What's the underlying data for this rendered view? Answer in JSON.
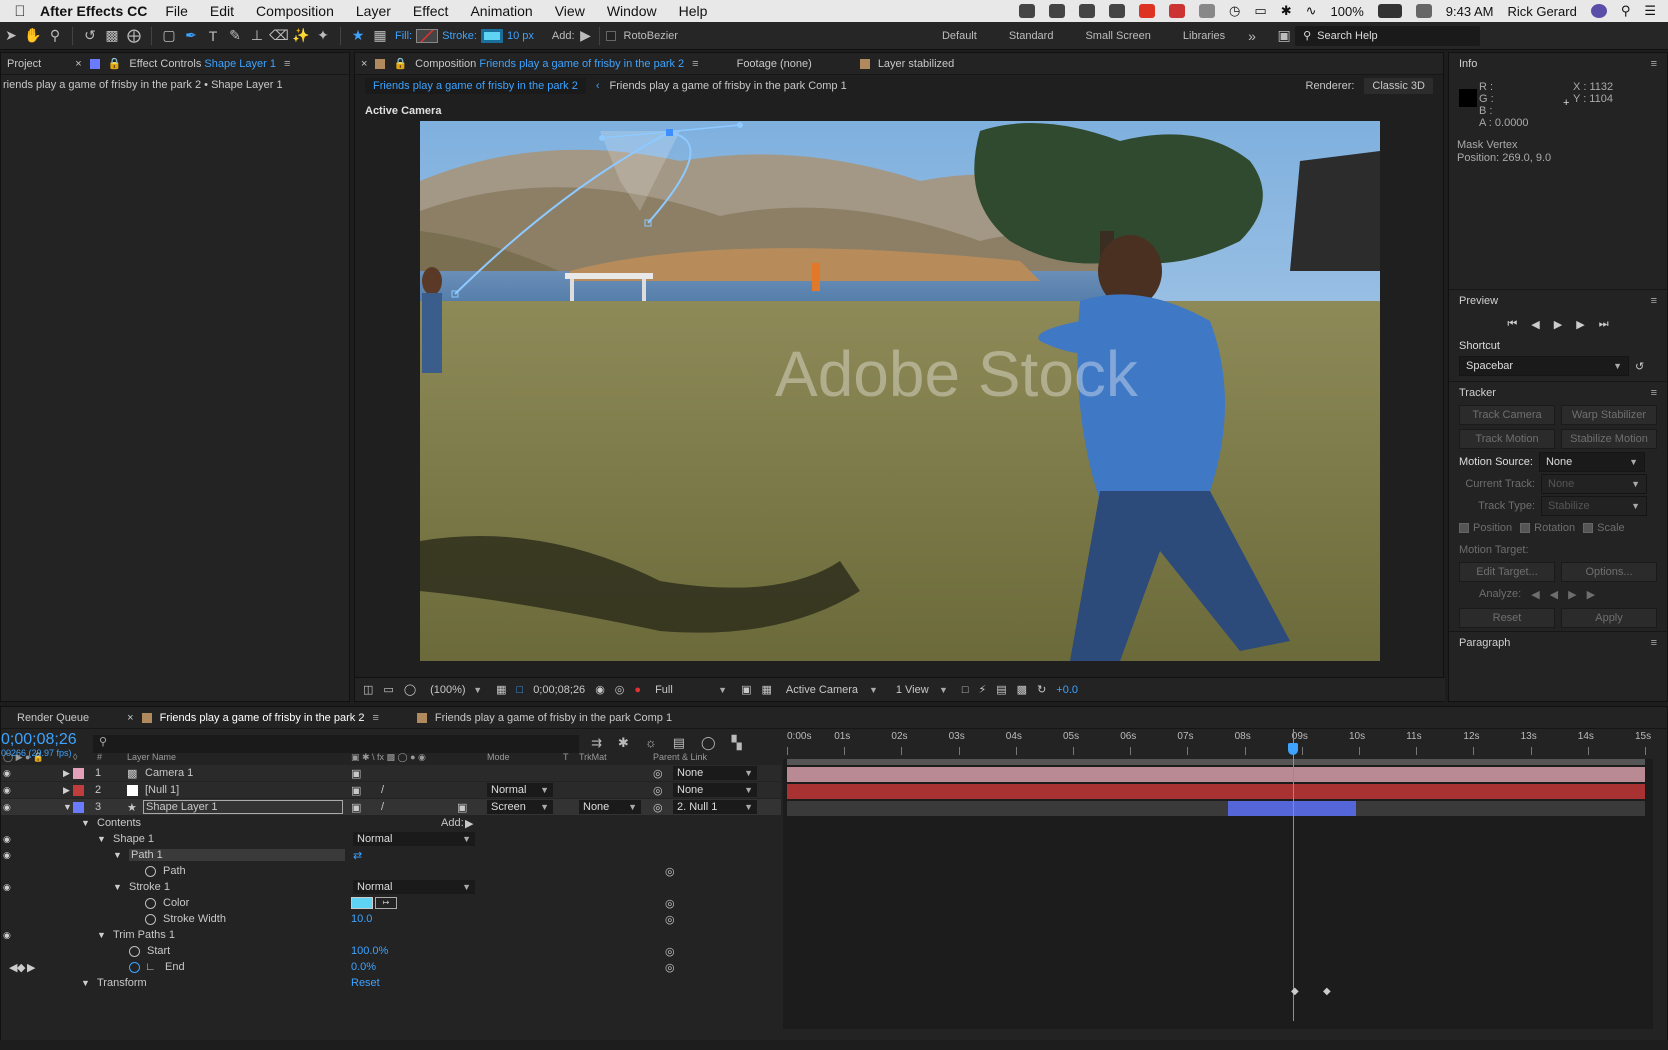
{
  "menubar": {
    "app_name": "After Effects CC",
    "menus": [
      "File",
      "Edit",
      "Composition",
      "Layer",
      "Effect",
      "Animation",
      "View",
      "Window",
      "Help"
    ],
    "battery": "100%",
    "time": "9:43 AM",
    "user": "Rick Gerard"
  },
  "toolbar": {
    "fill_label": "Fill:",
    "stroke_label": "Stroke:",
    "stroke_width": "10 px",
    "add_label": "Add:",
    "rotobezier": "RotoBezier",
    "workspaces": [
      "Default",
      "Standard",
      "Small Screen",
      "Libraries"
    ],
    "search_help": "Search Help",
    "stroke_color": "#5fd3f3"
  },
  "left_panel": {
    "tab_project": "Project",
    "tab_effect_controls_prefix": "Effect Controls",
    "tab_effect_controls_layer": "Shape Layer 1",
    "subtitle": "riends play a game of frisby in the park 2 • Shape Layer 1"
  },
  "comp_panel": {
    "tab_prefix": "Composition",
    "tab_comp_name": "Friends play a game of frisby in the park 2",
    "tab_footage": "Footage (none)",
    "tab_layer": "Layer stabilized",
    "breadcrumb_active": "Friends play a game of frisby in the park 2",
    "breadcrumb_parent": "Friends play a game of frisby in the park Comp 1",
    "renderer_label": "Renderer:",
    "renderer_value": "Classic 3D",
    "active_camera": "Active Camera",
    "watermark": "Adobe Stock",
    "footer": {
      "zoom": "(100%)",
      "timecode": "0;00;08;26",
      "resolution": "Full",
      "camera": "Active Camera",
      "views": "1 View",
      "exposure": "+0.0"
    }
  },
  "info_panel": {
    "title": "Info",
    "r": "R :",
    "g": "G :",
    "b": "B :",
    "a": "A : 0.0000",
    "x": "X : 1132",
    "y": "Y : 1104",
    "mask_vertex": "Mask Vertex",
    "position": "Position: 269.0, 9.0"
  },
  "preview_panel": {
    "title": "Preview",
    "shortcut_label": "Shortcut",
    "shortcut_value": "Spacebar"
  },
  "tracker_panel": {
    "title": "Tracker",
    "track_camera": "Track Camera",
    "warp_stabilizer": "Warp Stabilizer",
    "track_motion": "Track Motion",
    "stabilize_motion": "Stabilize Motion",
    "motion_source_label": "Motion Source:",
    "motion_source_value": "None",
    "current_track_label": "Current Track:",
    "current_track_value": "None",
    "track_type_label": "Track Type:",
    "track_type_value": "Stabilize",
    "position": "Position",
    "rotation": "Rotation",
    "scale": "Scale",
    "motion_target": "Motion Target:",
    "edit_target": "Edit Target...",
    "options": "Options...",
    "analyze": "Analyze:",
    "reset": "Reset",
    "apply": "Apply"
  },
  "paragraph_panel": {
    "title": "Paragraph"
  },
  "timeline": {
    "tab_render_queue": "Render Queue",
    "tab_comp": "Friends play a game of frisby in the park 2",
    "tab_comp2": "Friends play a game of frisby in the park Comp 1",
    "timecode": "0;00;08;26",
    "fps": "00266 (29.97 fps)",
    "col_hash": "#",
    "col_layer_name": "Layer Name",
    "col_mode": "Mode",
    "col_t": "T",
    "col_trkmat": "TrkMat",
    "col_parent": "Parent & Link",
    "ruler": [
      "0:00s",
      "01s",
      "02s",
      "03s",
      "04s",
      "05s",
      "06s",
      "07s",
      "08s",
      "09s",
      "10s",
      "11s",
      "12s",
      "13s",
      "14s",
      "15s"
    ],
    "playhead_fraction": 0.59,
    "layers": [
      {
        "num": "1",
        "name": "Camera 1",
        "color": "#e3a0b8",
        "parent": "None",
        "mode": "",
        "trkmat": ""
      },
      {
        "num": "2",
        "name": "[Null 1]",
        "color": "#c13c3c",
        "parent": "None",
        "mode": "Normal",
        "trkmat": ""
      },
      {
        "num": "3",
        "name": "Shape Layer 1",
        "color": "#6a7bff",
        "parent": "2. Null 1",
        "mode": "Screen",
        "trkmat": "None"
      }
    ],
    "properties": {
      "contents": "Contents",
      "add": "Add:",
      "shape1": "Shape 1",
      "shape1_mode": "Normal",
      "path1": "Path 1",
      "path": "Path",
      "stroke1": "Stroke 1",
      "stroke1_mode": "Normal",
      "color": "Color",
      "stroke_width": "Stroke Width",
      "stroke_width_val": "10.0",
      "trim_paths": "Trim Paths 1",
      "start": "Start",
      "start_val": "100.0%",
      "end": "End",
      "end_val": "0.0%",
      "transform": "Transform",
      "reset": "Reset"
    }
  }
}
